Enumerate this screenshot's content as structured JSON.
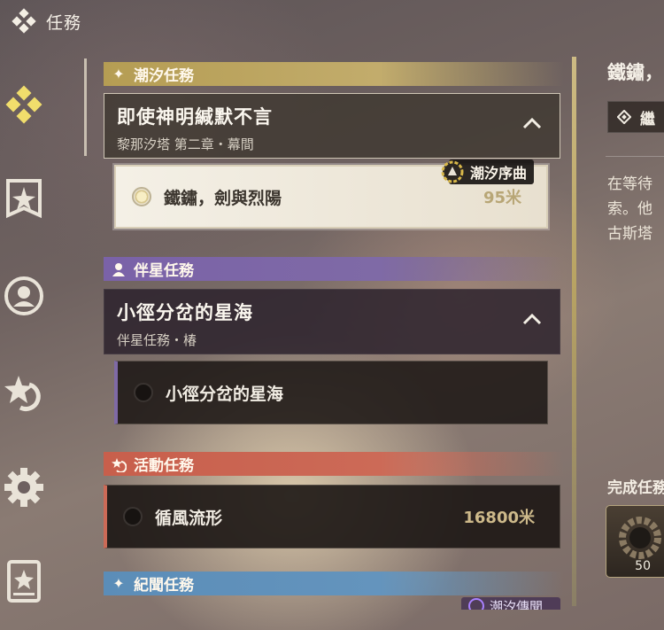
{
  "header": {
    "title": "任務",
    "logo_icon": "diamond-cluster-icon"
  },
  "sidenav": [
    {
      "name": "quest-tab",
      "icon": "diamond-cluster-icon",
      "active": true
    },
    {
      "name": "chronicle-tab",
      "icon": "banner-star-icon"
    },
    {
      "name": "companion-tab",
      "icon": "person-circle-icon"
    },
    {
      "name": "event-tab",
      "icon": "star-swirl-icon"
    },
    {
      "name": "settings-tab",
      "icon": "gear-icon"
    },
    {
      "name": "archive-tab",
      "icon": "book-star-icon"
    }
  ],
  "categories": {
    "tide": {
      "label": "潮汐任務",
      "color": "#b59d53",
      "icon": "sparkle-icon"
    },
    "companion": {
      "label": "伴星任務",
      "color": "#7a62a8",
      "icon": "person-icon"
    },
    "event": {
      "label": "活動任務",
      "color": "#c85f4c",
      "icon": "swirl-star-icon"
    },
    "lore": {
      "label": "紀聞任務",
      "color": "#5b8db8",
      "icon": "sparkle-icon"
    }
  },
  "tide_quest": {
    "title": "即使神明緘默不言",
    "subtitle": "黎那汐塔 第二章・幕間",
    "badge": "潮汐序曲",
    "task": {
      "name": "鐵鏽，劍與烈陽",
      "distance": "95米",
      "selected": true
    }
  },
  "companion_quest": {
    "title": "小徑分岔的星海",
    "subtitle": "伴星任務・椿",
    "task": {
      "name": "小徑分岔的星海"
    }
  },
  "event_quest": {
    "task": {
      "name": "循風流形",
      "distance": "16800米"
    }
  },
  "lore_quest": {
    "badge": "潮汐傳聞"
  },
  "detail": {
    "title": "鐵鏽，",
    "continue_label": "繼",
    "description": [
      "在等待",
      "索。他",
      "古斯塔"
    ],
    "reward_title": "完成任務",
    "reward_count": "50"
  }
}
